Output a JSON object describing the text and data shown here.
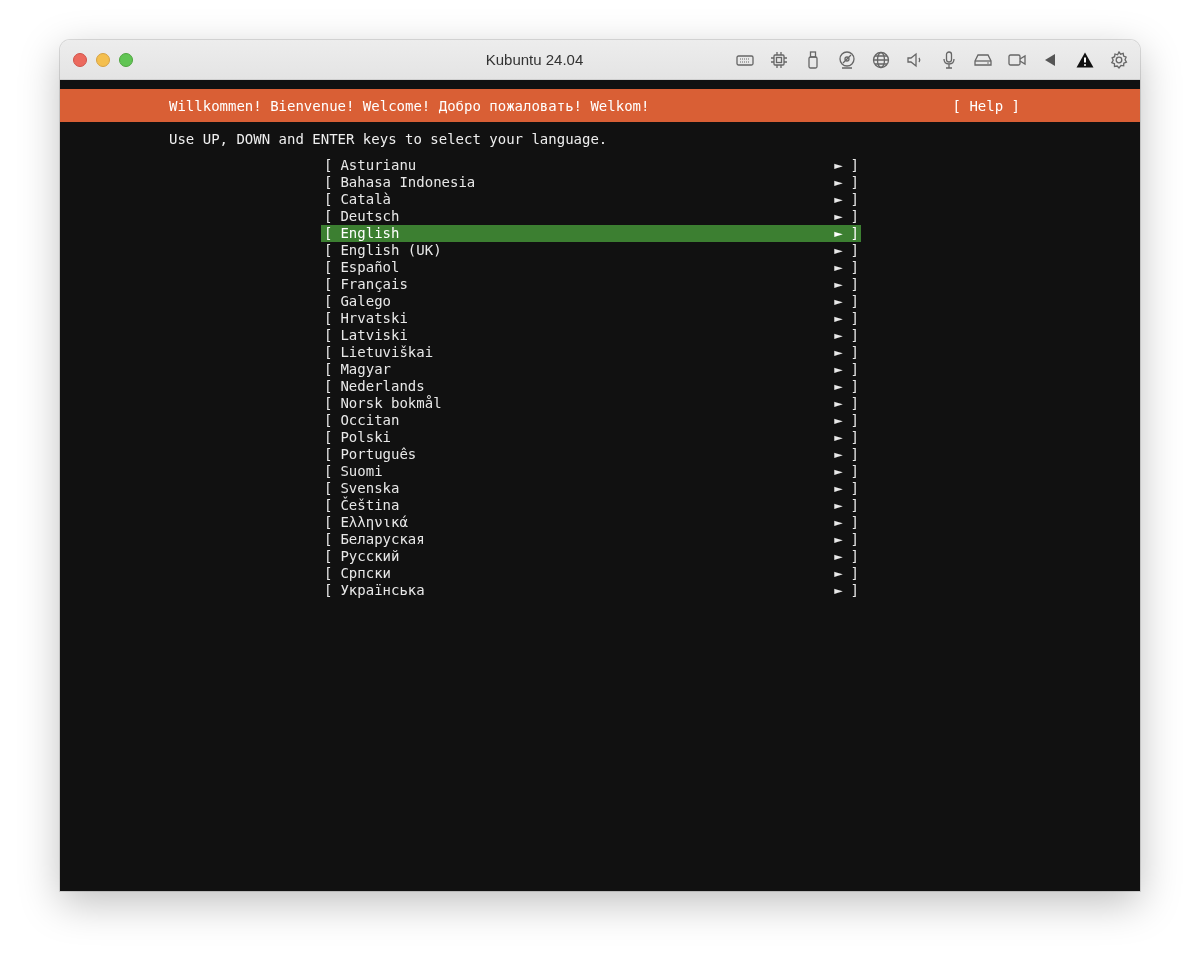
{
  "window": {
    "title": "Kubuntu 24.04"
  },
  "header": {
    "title": "Willkommen! Bienvenue! Welcome! Добро пожаловать! Welkom!",
    "help": "[ Help ]"
  },
  "instruction": "Use UP, DOWN and ENTER keys to select your language.",
  "languages": [
    {
      "open": "[",
      "label": "Asturianu",
      "arrow": "►",
      "close": "]",
      "selected": false
    },
    {
      "open": "[",
      "label": "Bahasa Indonesia",
      "arrow": "►",
      "close": "]",
      "selected": false
    },
    {
      "open": "[",
      "label": "Català",
      "arrow": "►",
      "close": "]",
      "selected": false
    },
    {
      "open": "[",
      "label": "Deutsch",
      "arrow": "►",
      "close": "]",
      "selected": false
    },
    {
      "open": "[",
      "label": "English",
      "arrow": "►",
      "close": "]",
      "selected": true
    },
    {
      "open": "[",
      "label": "English (UK)",
      "arrow": "►",
      "close": "]",
      "selected": false
    },
    {
      "open": "[",
      "label": "Español",
      "arrow": "►",
      "close": "]",
      "selected": false
    },
    {
      "open": "[",
      "label": "Français",
      "arrow": "►",
      "close": "]",
      "selected": false
    },
    {
      "open": "[",
      "label": "Galego",
      "arrow": "►",
      "close": "]",
      "selected": false
    },
    {
      "open": "[",
      "label": "Hrvatski",
      "arrow": "►",
      "close": "]",
      "selected": false
    },
    {
      "open": "[",
      "label": "Latviski",
      "arrow": "►",
      "close": "]",
      "selected": false
    },
    {
      "open": "[",
      "label": "Lietuviškai",
      "arrow": "►",
      "close": "]",
      "selected": false
    },
    {
      "open": "[",
      "label": "Magyar",
      "arrow": "►",
      "close": "]",
      "selected": false
    },
    {
      "open": "[",
      "label": "Nederlands",
      "arrow": "►",
      "close": "]",
      "selected": false
    },
    {
      "open": "[",
      "label": "Norsk bokmål",
      "arrow": "►",
      "close": "]",
      "selected": false
    },
    {
      "open": "[",
      "label": "Occitan",
      "arrow": "►",
      "close": "]",
      "selected": false
    },
    {
      "open": "[",
      "label": "Polski",
      "arrow": "►",
      "close": "]",
      "selected": false
    },
    {
      "open": "[",
      "label": "Português",
      "arrow": "►",
      "close": "]",
      "selected": false
    },
    {
      "open": "[",
      "label": "Suomi",
      "arrow": "►",
      "close": "]",
      "selected": false
    },
    {
      "open": "[",
      "label": "Svenska",
      "arrow": "►",
      "close": "]",
      "selected": false
    },
    {
      "open": "[",
      "label": "Čeština",
      "arrow": "►",
      "close": "]",
      "selected": false
    },
    {
      "open": "[",
      "label": "Ελληνικά",
      "arrow": "►",
      "close": "]",
      "selected": false
    },
    {
      "open": "[",
      "label": "Беларуская",
      "arrow": "►",
      "close": "]",
      "selected": false
    },
    {
      "open": "[",
      "label": "Русский",
      "arrow": "►",
      "close": "]",
      "selected": false
    },
    {
      "open": "[",
      "label": "Српски",
      "arrow": "►",
      "close": "]",
      "selected": false
    },
    {
      "open": "[",
      "label": "Українська",
      "arrow": "►",
      "close": "]",
      "selected": false
    }
  ]
}
